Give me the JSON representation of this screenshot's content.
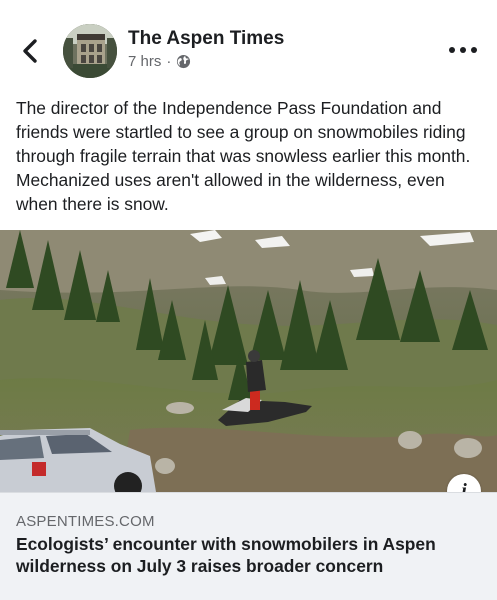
{
  "post": {
    "page_name": "The Aspen Times",
    "timestamp": "7 hrs",
    "separator": "·",
    "audience_icon": "globe-icon",
    "text": "The director of the Independence Pass Foundation and friends were startled to see a group on snowmobiles riding through fragile terrain that was snowless earlier this month. Mechanized uses aren't allowed in the wilderness, even when there is snow."
  },
  "link_preview": {
    "domain": "ASPENTIMES.COM",
    "title": "Ecologists’ encounter with snowmobilers in Aspen wilderness on July 3 raises broader concern",
    "info_label": "i"
  },
  "icons": {
    "back": "chevron-left-icon",
    "more": "more-horizontal-icon",
    "info": "info-icon"
  }
}
